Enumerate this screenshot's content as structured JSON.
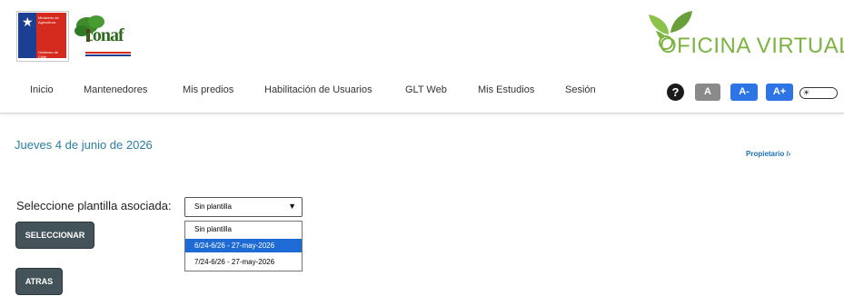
{
  "header": {
    "gov_logo_text_top": "Ministerio de Agricultura",
    "gov_logo_text_bottom": "Gobierno de Chile",
    "conaf_logo_text": "conaf",
    "app_title": "OFICINA VIRTUAL"
  },
  "nav": {
    "items": [
      {
        "label": "Inicio"
      },
      {
        "label": "Mantenedores"
      },
      {
        "label": "Mis predios"
      },
      {
        "label": "Habilitación de Usuarios"
      },
      {
        "label": "GLT Web"
      },
      {
        "label": "Mis Estudios"
      },
      {
        "label": "Sesión"
      }
    ]
  },
  "accessibility": {
    "help_label": "?",
    "font_normal": "A",
    "font_decrease": "A-",
    "font_increase": "A+"
  },
  "main": {
    "date": "Jueves 4 de junio de 2026",
    "breadcrumb": "Propietario /›",
    "select_label": "Seleccione plantilla asociada:",
    "select_value": "Sin plantilla",
    "options": [
      {
        "label": "Sin plantilla",
        "selected": false
      },
      {
        "label": "6/24-6/26 - 27-may-2026",
        "selected": true
      },
      {
        "label": "7/24-6/26 - 27-may-2026",
        "selected": false
      }
    ],
    "select_button": "SELECCIONAR",
    "back_button": "ATRAS"
  },
  "colors": {
    "accent_green": "#7cb342",
    "link_blue": "#1e6fb8",
    "button_dark": "#44535a",
    "font_gray": "#8a8a8a",
    "font_blue": "#2d74e6",
    "option_highlight": "#1e6bd6"
  },
  "icons": [
    "chile-gov-logo-icon",
    "conaf-tree-icon",
    "leaf-icon",
    "help-icon",
    "sun-icon",
    "chevron-down-icon"
  ]
}
